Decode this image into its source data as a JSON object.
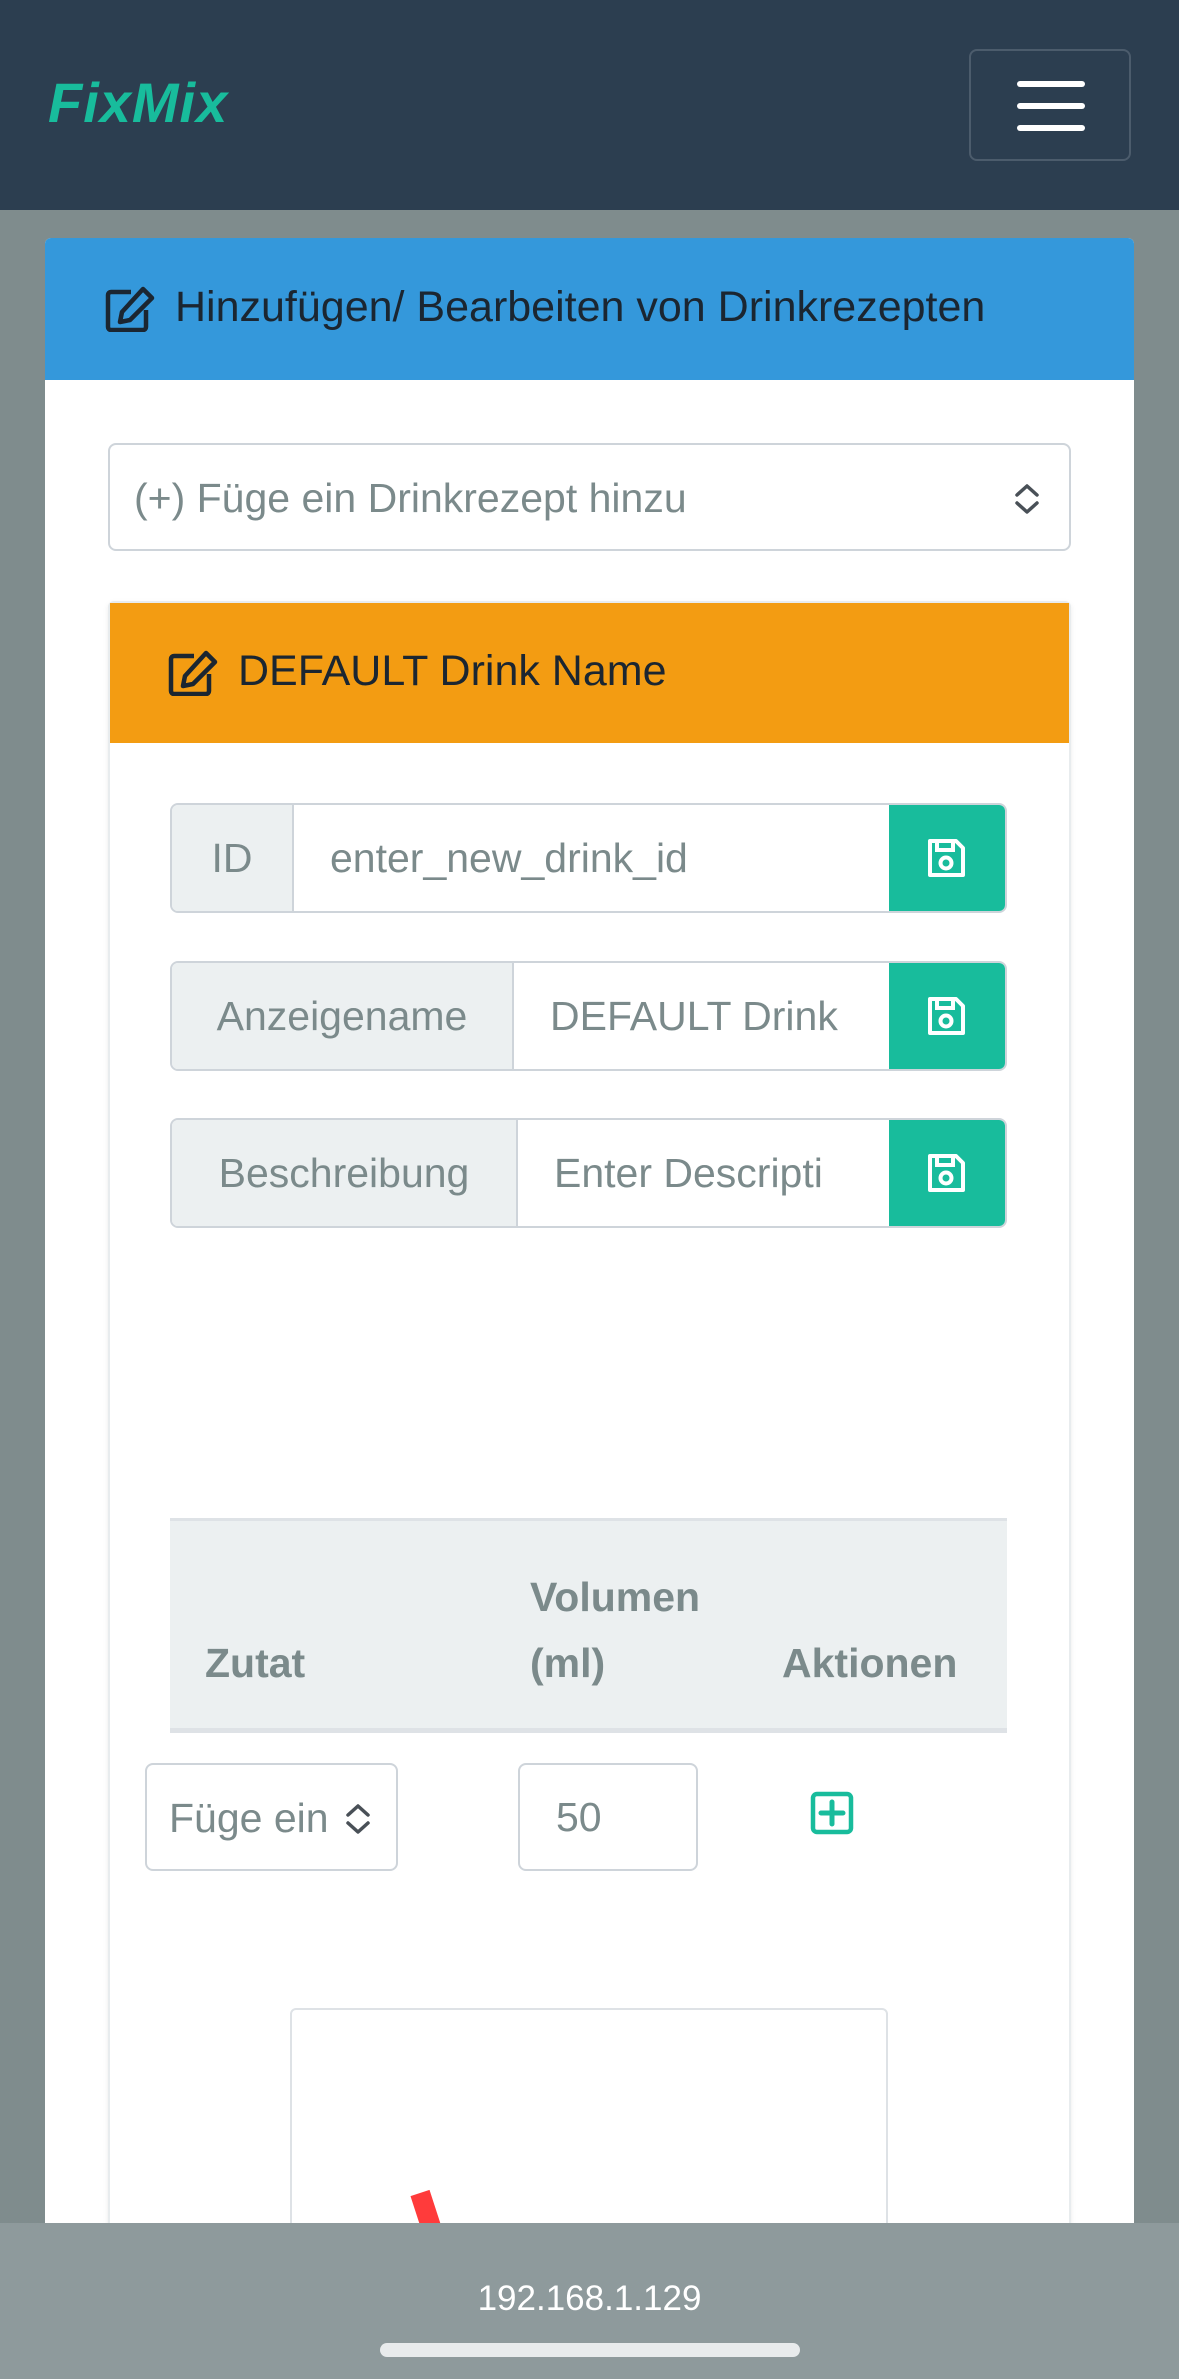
{
  "navbar": {
    "brand": "FixMix"
  },
  "main_card": {
    "title": "Hinzufügen/ Bearbeiten von Drinkrezepten",
    "select": {
      "value": "(+) Füge ein Drinkrezept hinzu"
    }
  },
  "drink_card": {
    "title": "DEFAULT Drink Name",
    "fields": {
      "id_label": "ID",
      "id_placeholder": "enter_new_drink_id",
      "name_label": "Anzeigename",
      "name_value": "DEFAULT Drink",
      "desc_label": "Beschreibung",
      "desc_placeholder": "Enter Descripti"
    },
    "table": {
      "col_ingredient": "Zutat",
      "col_volume_line1": "Volumen",
      "col_volume_line2": "(ml)",
      "col_actions": "Aktionen",
      "row": {
        "ingredient_select": "Füge ein",
        "volume": "50"
      }
    }
  },
  "browser": {
    "url": "192.168.1.129"
  },
  "colors": {
    "navbar": "#2c3e50",
    "brand": "#18bc9c",
    "primary_header": "#3498db",
    "warning_header": "#f39c12",
    "success": "#18bc9c"
  },
  "icons": [
    "menu-icon",
    "edit-icon",
    "select-updown-icon",
    "save-icon",
    "plus-square-icon"
  ]
}
